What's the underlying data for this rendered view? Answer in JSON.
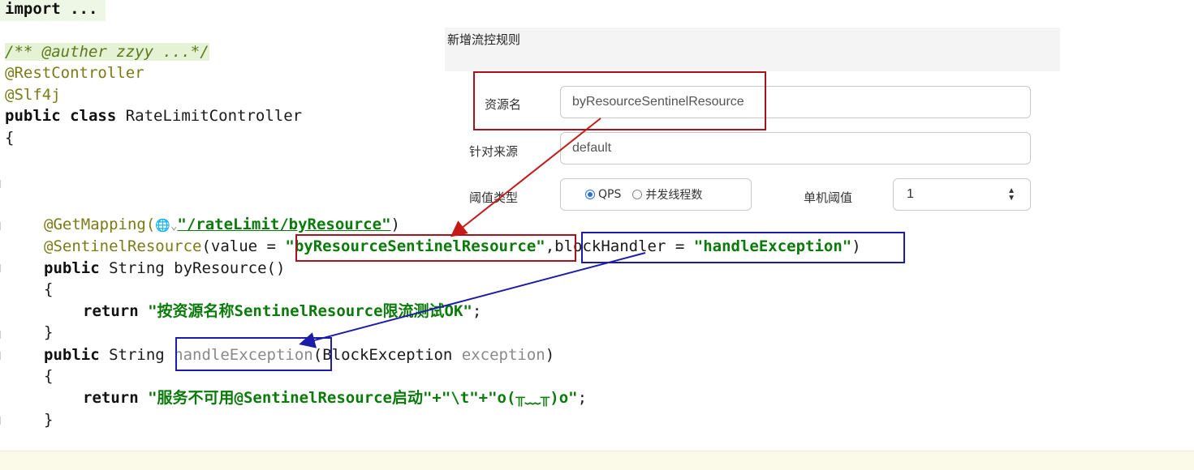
{
  "code": {
    "import_kw": "import",
    "import_rest": " ...",
    "comment": "/** @auther zzyy ...*/",
    "ann_rest": "@RestController",
    "ann_slf": "@Slf4j",
    "class_kw1": "public",
    "class_kw2": "class",
    "class_name": " RateLimitController",
    "brace_open": "{",
    "getmapping_ann": "@GetMapping(",
    "getmapping_icon": "🌐",
    "getmapping_chev": "⌄",
    "getmapping_str": "\"/rateLimit/byResource\"",
    "getmapping_close": ")",
    "sentinel_ann": "@SentinelResource",
    "sentinel_open": "(value = ",
    "sentinel_value": "\"byResourceSentinelResource\"",
    "sentinel_comma": ",",
    "block_key": "blockHandler = ",
    "block_value": "\"handleException\"",
    "sentinel_close": ")",
    "m1_public": "public",
    "m1_sig": " String byResource()",
    "m1_open": "{",
    "m1_return_kw": "return",
    "m1_return_str": "\"按资源名称SentinelResource限流测试OK\"",
    "m1_semicolon": ";",
    "m1_close": "}",
    "m2_public": "public",
    "m2_type": " String ",
    "m2_name": "handleException",
    "m2_params_open": "(BlockException ",
    "m2_param": "exception",
    "m2_params_close": ")",
    "m2_open": "{",
    "m2_return_kw": "return",
    "m2_return_expr": "\"服务不可用@SentinelResource启动\"+\"\\t\"+\"o(╥﹏╥)o\"",
    "m2_semicolon": ";",
    "m2_close": "}"
  },
  "dialog": {
    "title": "新增流控规则",
    "resource_label": "资源名",
    "resource_value": "byResourceSentinelResource",
    "origin_label": "针对来源",
    "origin_value": "default",
    "threshold_type_label": "阈值类型",
    "radio_qps": "QPS",
    "radio_threads": "并发线程数",
    "single_threshold_label": "单机阈值",
    "single_threshold_value": "1"
  },
  "colors": {
    "red_highlight": "#a8121c",
    "blue_highlight": "#1c1ca8",
    "string_green": "#0a7a0a",
    "annotation_olive": "#7a7a16"
  },
  "icons": {
    "globe": "globe-icon",
    "chevron": "chevron-down-icon",
    "spinner": "spinner-icon"
  }
}
